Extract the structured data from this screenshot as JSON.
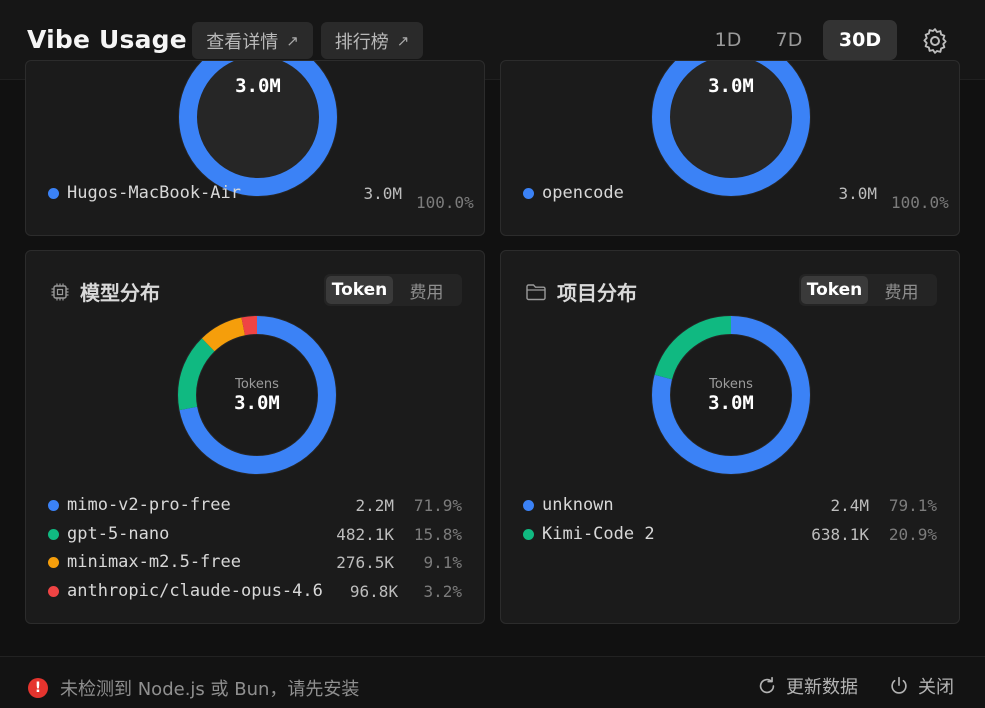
{
  "app": {
    "title": "Vibe Usage"
  },
  "header": {
    "details_label": "查看详情",
    "ranking_label": "排行榜",
    "ranges": [
      "1D",
      "7D",
      "30D"
    ],
    "active_range": "30D"
  },
  "top_panels": [
    {
      "center_value": "3.0M",
      "items": [
        {
          "name": "Hugos-MacBook-Air",
          "value": "3.0M",
          "pct": "100.0%",
          "color": "#3b82f6"
        }
      ]
    },
    {
      "center_value": "3.0M",
      "items": [
        {
          "name": "opencode",
          "value": "3.0M",
          "pct": "100.0%",
          "color": "#3b82f6"
        }
      ]
    }
  ],
  "model_panel": {
    "title": "模型分布",
    "toggle": [
      "Token",
      "费用"
    ],
    "center_label": "Tokens",
    "center_value": "3.0M",
    "items": [
      {
        "name": "mimo-v2-pro-free",
        "value": "2.2M",
        "pct": "71.9%",
        "share": 71.9,
        "color": "#3b82f6"
      },
      {
        "name": "gpt-5-nano",
        "value": "482.1K",
        "pct": "15.8%",
        "share": 15.8,
        "color": "#10b981"
      },
      {
        "name": "minimax-m2.5-free",
        "value": "276.5K",
        "pct": "9.1%",
        "share": 9.1,
        "color": "#f59e0b"
      },
      {
        "name": "anthropic/claude-opus-4.6",
        "value": "96.8K",
        "pct": "3.2%",
        "share": 3.2,
        "color": "#ef4444"
      }
    ]
  },
  "project_panel": {
    "title": "项目分布",
    "toggle": [
      "Token",
      "费用"
    ],
    "center_label": "Tokens",
    "center_value": "3.0M",
    "items": [
      {
        "name": "unknown",
        "value": "2.4M",
        "pct": "79.1%",
        "share": 79.1,
        "color": "#3b82f6"
      },
      {
        "name": "Kimi-Code 2",
        "value": "638.1K",
        "pct": "20.9%",
        "share": 20.9,
        "color": "#10b981"
      }
    ]
  },
  "footer": {
    "warning": "未检测到 Node.js 或 Bun，请先安装",
    "refresh_label": "更新数据",
    "close_label": "关闭"
  }
}
